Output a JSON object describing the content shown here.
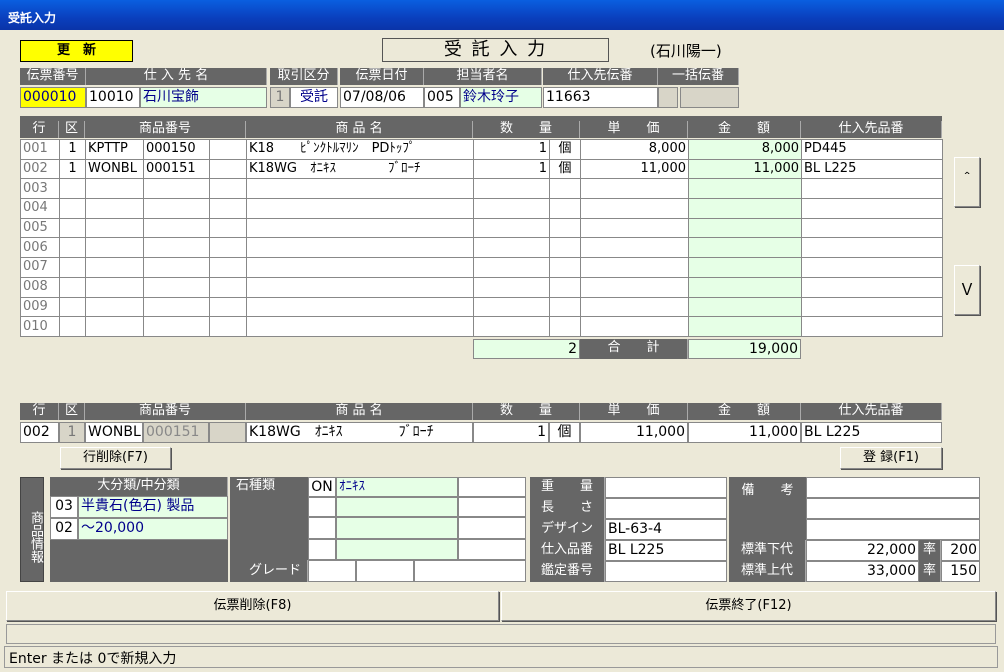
{
  "window": {
    "title": "受託入力"
  },
  "header": {
    "mode": "更　新",
    "title": "受 託 入 力",
    "user": "(石川陽一)"
  },
  "slip": {
    "headers": [
      "伝票番号",
      "仕 入 先 名",
      "取引区分",
      "伝票日付",
      "担当者名",
      "仕入先伝番",
      "一括伝番"
    ],
    "number": "000010",
    "supplier_code": "10010",
    "supplier_name": "石川宝飾",
    "type_code": "1",
    "type_name": "受託",
    "date": "07/08/06",
    "staff_code": "005",
    "staff_name": "鈴木玲子",
    "supplier_slip": "11663",
    "bulk_slip": ""
  },
  "lines": {
    "headers": [
      "行",
      "区",
      "商品番号",
      "商 品 名",
      "数　　量",
      "単　　価",
      "金　　額",
      "仕入先品番"
    ],
    "rows": [
      {
        "no": "001",
        "ku": "1",
        "code1": "KPTTP",
        "code2": "000150",
        "name": "K18　　ﾋﾟﾝｸﾄﾙﾏﾘﾝ　PDﾄｯﾌﾟ",
        "qty": "1",
        "unit": "個",
        "price": "8,000",
        "amount": "8,000",
        "sup": "PD445"
      },
      {
        "no": "002",
        "ku": "1",
        "code1": "WONBL",
        "code2": "000151",
        "name": "K18WG　ｵﾆｷｽ　　　　ﾌﾞﾛｰﾁ",
        "qty": "1",
        "unit": "個",
        "price": "11,000",
        "amount": "11,000",
        "sup": "BL L225"
      },
      {
        "no": "003"
      },
      {
        "no": "004"
      },
      {
        "no": "005"
      },
      {
        "no": "006"
      },
      {
        "no": "007"
      },
      {
        "no": "008"
      },
      {
        "no": "009"
      },
      {
        "no": "010"
      }
    ],
    "total_qty": "2",
    "total_label": "合　　計",
    "total_amount": "19,000"
  },
  "scroll": {
    "up": "＾",
    "down": "Ｖ"
  },
  "edit": {
    "no": "002",
    "ku": "1",
    "code1": "WONBL",
    "code2": "000151",
    "name": "K18WG　ｵﾆｷｽ　　　　ﾌﾞﾛｰﾁ",
    "qty": "1",
    "unit": "個",
    "price": "11,000",
    "amount": "11,000",
    "sup": "BL L225"
  },
  "buttons": {
    "row_delete": "行削除(F7)",
    "register": "登 録(F1)",
    "slip_delete": "伝票削除(F8)",
    "slip_end": "伝票終了(F12)"
  },
  "info": {
    "side_label": "商品情報",
    "category_header": "大分類/中分類",
    "cat1_code": "03",
    "cat1_name": "半貴石(色石) 製品",
    "cat2_code": "02",
    "cat2_name": "～20,000",
    "stone_label": "石種類",
    "stone_on": "ON",
    "stone_name": "ｵﾆｷｽ",
    "grade_label": "グレード",
    "weight_label": "重　　量",
    "length_label": "長　　さ",
    "design_label": "デザイン",
    "design_value": "BL-63-4",
    "sup_item_label": "仕入品番",
    "sup_item_value": "BL L225",
    "appraisal_label": "鑑定番号",
    "remarks_label": "備　　考",
    "std_low_label": "標準下代",
    "std_low_value": "22,000",
    "rate_label": "率",
    "rate_low": "200",
    "std_high_label": "標準上代",
    "std_high_value": "33,000",
    "rate_high": "150"
  },
  "status": {
    "message": "Enter または 0で新規入力"
  }
}
